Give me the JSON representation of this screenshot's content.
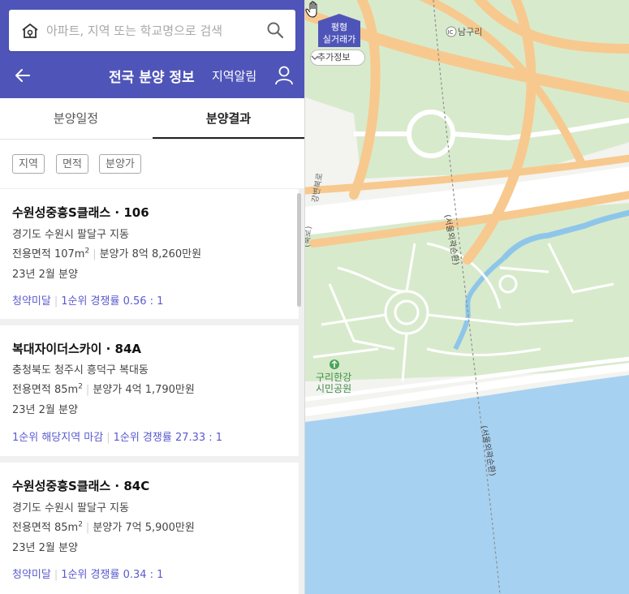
{
  "search": {
    "placeholder": "아파트, 지역 또는 학교명으로 검색"
  },
  "header": {
    "title": "전국 분양 정보",
    "alarm_label": "지역알림"
  },
  "tabs": [
    {
      "label": "분양일정",
      "active": false
    },
    {
      "label": "분양결과",
      "active": true
    }
  ],
  "filters": [
    "지역",
    "면적",
    "분양가"
  ],
  "listings": [
    {
      "name": "수원성중흥S클래스 · 106",
      "address": "경기도 수원시 팔달구 지동",
      "area": "전용면적 107m",
      "price": "분양가 8억 8,260만원",
      "date": "23년 2월 분양",
      "status": [
        "청약미달",
        "1순위 경쟁률 0.56 : 1"
      ]
    },
    {
      "name": "복대자이더스카이 · 84A",
      "address": "충청북도 청주시 흥덕구 복대동",
      "area": "전용면적 85m",
      "price": "분양가 4억 1,790만원",
      "date": "23년 2월 분양",
      "status": [
        "1순위 해당지역 마감",
        "1순위 경쟁률 27.33 : 1"
      ]
    },
    {
      "name": "수원성중흥S클래스 · 84C",
      "address": "경기도 수원시 팔달구 지동",
      "area": "전용면적 85m",
      "price": "분양가 7억 5,900만원",
      "date": "23년 2월 분양",
      "status": [
        "청약미달",
        "1순위 경쟁률 0.34 : 1"
      ]
    }
  ],
  "map": {
    "badge_line1": "평형",
    "badge_line2": "실거래가",
    "more_info": "추가정보",
    "ic_label": "남구리",
    "ic_badge": "IC",
    "park_name_1": "구리한강",
    "park_name_2": "시민공원",
    "highway_label_1": "(서울외곽순환)",
    "highway_label_2": "(서울외곽순환)",
    "road_label_1": "강변북로",
    "road_label_2": "(북로)"
  },
  "colors": {
    "header_bg": "#4f55b8",
    "accent_link": "#5a5ad0",
    "water": "#a7d1f1",
    "park": "#d9ebcf",
    "road_major": "#f7c98e"
  }
}
